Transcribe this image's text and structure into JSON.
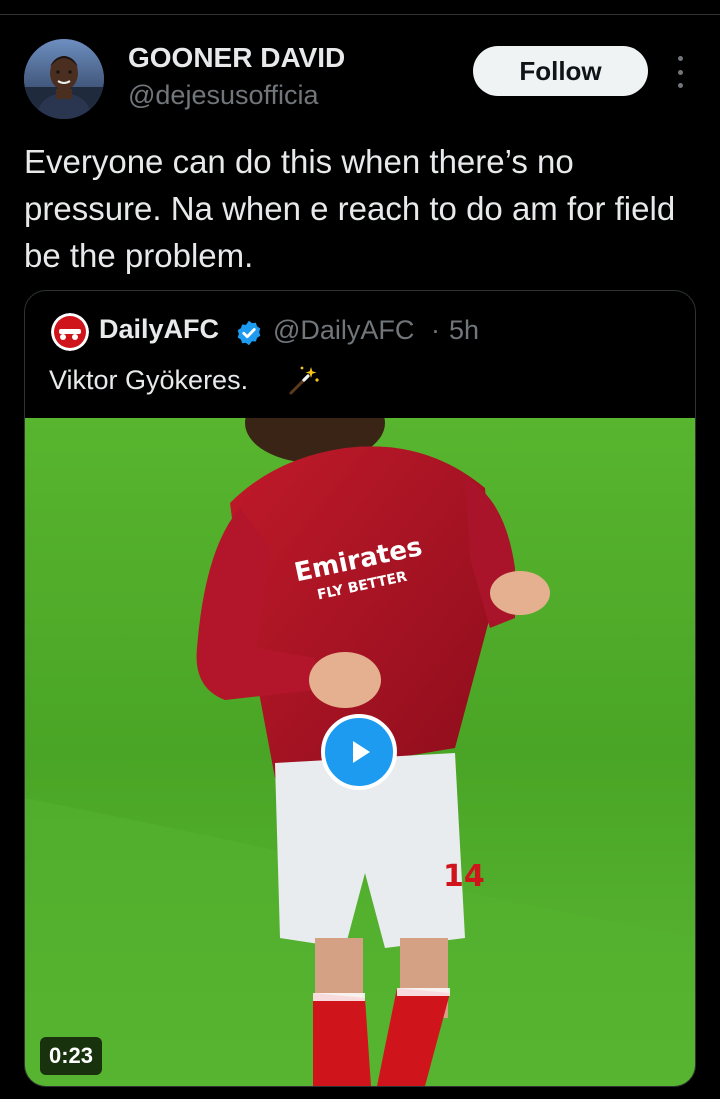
{
  "tweet": {
    "author_name": "GOONER DAVID",
    "author_handle": "@dejesusofficia",
    "follow_label": "Follow",
    "text": "Everyone can do this when there’s no pressure. Na when e reach to do am for field be the problem."
  },
  "quote": {
    "author_name": "DailyAFC",
    "author_handle": "@DailyAFC",
    "separator": "·",
    "time": "5h",
    "text": "Viktor Gyökeres.",
    "emoji_icon": "magic-wand-icon",
    "video_duration": "0:23",
    "sponsor_text": "Emirates",
    "sponsor_subtext": "FLY BETTER"
  },
  "icons": {
    "more": "more-vertical-icon",
    "verified": "verified-badge-icon",
    "play": "play-icon"
  },
  "colors": {
    "background": "#000000",
    "text_primary": "#e7e9ea",
    "text_secondary": "#71767b",
    "accent_blue": "#1d9bf0",
    "follow_bg": "#eff3f4",
    "border": "#2f3336"
  }
}
